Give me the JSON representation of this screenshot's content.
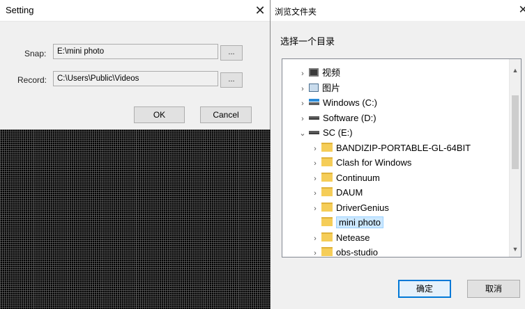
{
  "setting_dialog": {
    "title": "Setting",
    "close_glyph": "✕",
    "snap": {
      "label": "Snap:",
      "value": "E:\\mini photo",
      "browse_label": "..."
    },
    "record": {
      "label": "Record:",
      "value": "C:\\Users\\Public\\Videos",
      "browse_label": "..."
    },
    "ok_label": "OK",
    "cancel_label": "Cancel"
  },
  "browse_dialog": {
    "title": "浏览文件夹",
    "close_glyph": "✕",
    "subtitle": "选择一个目录",
    "tree": [
      {
        "label": "视频",
        "icon": "video-icon",
        "expand": "collapsed"
      },
      {
        "label": "图片",
        "icon": "picture-icon",
        "expand": "collapsed"
      },
      {
        "label": "Windows (C:)",
        "icon": "windows-drive-icon",
        "expand": "collapsed"
      },
      {
        "label": "Software (D:)",
        "icon": "drive-icon",
        "expand": "collapsed"
      },
      {
        "label": "SC (E:)",
        "icon": "drive-icon",
        "expand": "expanded"
      },
      {
        "label": "BANDIZIP-PORTABLE-GL-64BIT",
        "icon": "folder-icon",
        "expand": "collapsed"
      },
      {
        "label": "Clash for Windows",
        "icon": "folder-icon",
        "expand": "collapsed"
      },
      {
        "label": "Continuum",
        "icon": "folder-icon",
        "expand": "collapsed"
      },
      {
        "label": "DAUM",
        "icon": "folder-icon",
        "expand": "collapsed"
      },
      {
        "label": "DriverGenius",
        "icon": "folder-icon",
        "expand": "collapsed"
      },
      {
        "label": "mini photo",
        "icon": "folder-icon",
        "expand": "none",
        "selected": true
      },
      {
        "label": "Netease",
        "icon": "folder-icon",
        "expand": "collapsed"
      },
      {
        "label": "obs-studio",
        "icon": "folder-icon",
        "expand": "collapsed"
      }
    ],
    "confirm_label": "确定",
    "cancel_label": "取消"
  },
  "colors": {
    "selection_bg": "#cce8ff",
    "default_button_border": "#0078d7",
    "folder": "#f5cd58"
  }
}
